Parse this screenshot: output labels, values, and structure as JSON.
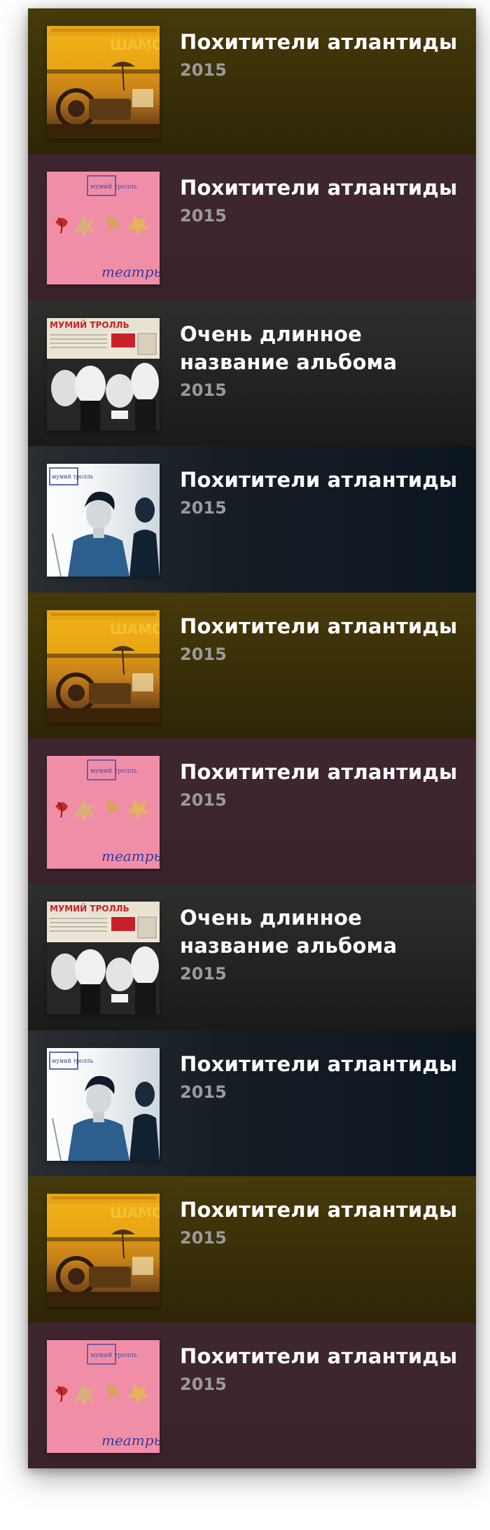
{
  "albums": [
    {
      "title": "Похитители атлантиды",
      "year": "2015",
      "cover_style": "shamora",
      "row_style": "gold",
      "cover_text": "ШАМОРА"
    },
    {
      "title": "Похитители атлантиды",
      "year": "2015",
      "cover_style": "pink",
      "row_style": "plum",
      "cover_text": "мумий тролль",
      "cover_script": "театры"
    },
    {
      "title": "Очень длинное название альбома",
      "year": "2015",
      "cover_style": "band",
      "row_style": "charcoal",
      "cover_text": "МУМИЙ ТРОЛЛЬ"
    },
    {
      "title": "Похитители атлантиды",
      "year": "2015",
      "cover_style": "blue",
      "row_style": "navy",
      "cover_text": "мумий тролль"
    },
    {
      "title": "Похитители атлантиды",
      "year": "2015",
      "cover_style": "shamora",
      "row_style": "gold",
      "cover_text": "ШАМОРА"
    },
    {
      "title": "Похитители атлантиды",
      "year": "2015",
      "cover_style": "pink",
      "row_style": "plum",
      "cover_text": "мумий тролль",
      "cover_script": "театры"
    },
    {
      "title": "Очень длинное название альбома",
      "year": "2015",
      "cover_style": "band",
      "row_style": "charcoal",
      "cover_text": "МУМИЙ ТРОЛЛЬ"
    },
    {
      "title": "Похитители атлантиды",
      "year": "2015",
      "cover_style": "blue",
      "row_style": "navy",
      "cover_text": "мумий тролль"
    },
    {
      "title": "Похитители атлантиды",
      "year": "2015",
      "cover_style": "shamora",
      "row_style": "gold",
      "cover_text": "ШАМОРА"
    },
    {
      "title": "Похитители атлантиды",
      "year": "2015",
      "cover_style": "pink",
      "row_style": "plum",
      "cover_text": "мумий тролль",
      "cover_script": "театры"
    }
  ],
  "colors": {
    "title": "#ffffff",
    "year": "#9a9a9a",
    "row_gold": "#3e3309",
    "row_plum": "#3d2530",
    "row_charcoal": "#262626",
    "row_navy": "#141c25"
  }
}
